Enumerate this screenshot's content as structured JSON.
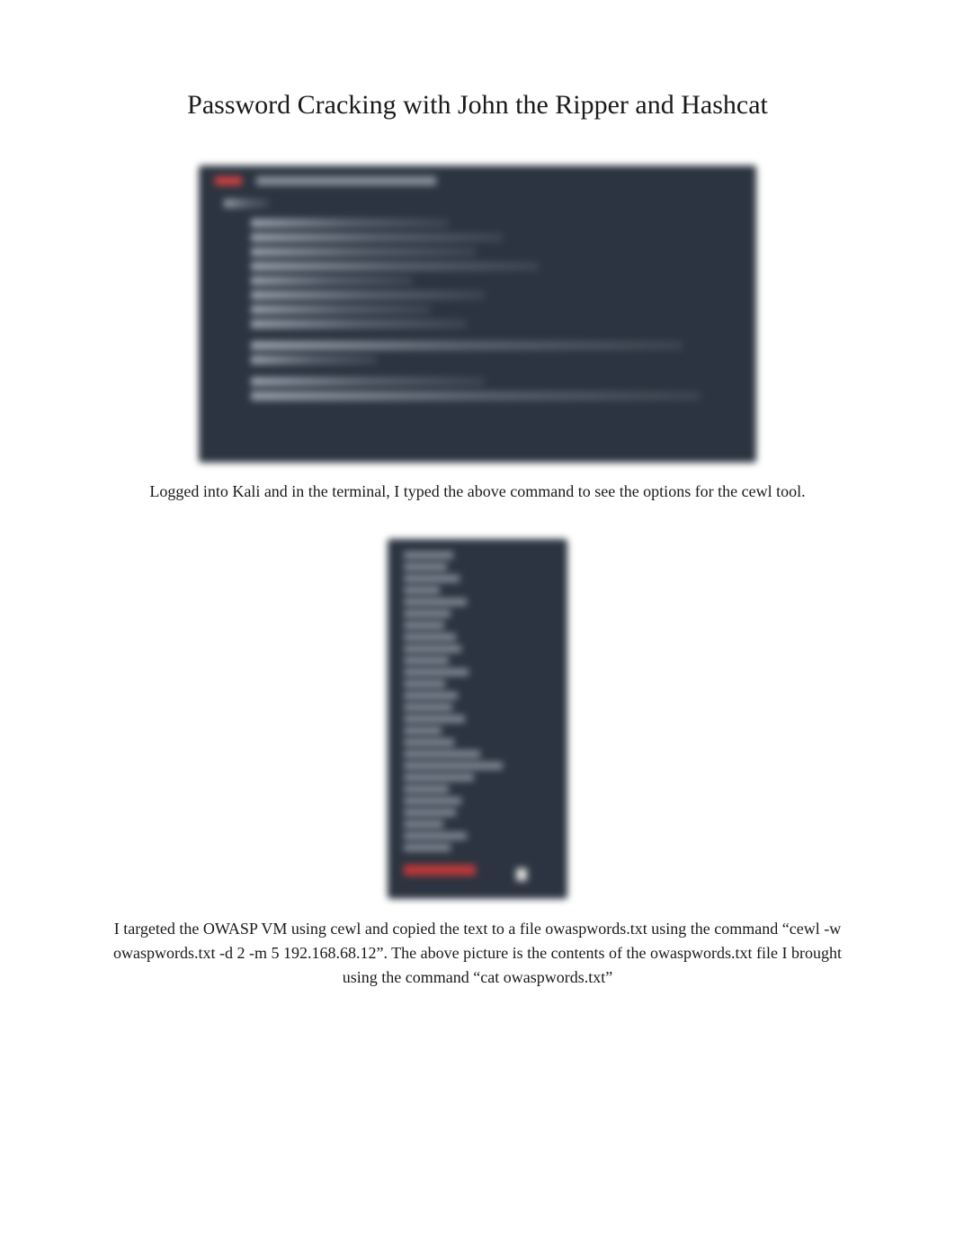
{
  "title": "Password Cracking with John the Ripper and Hashcat",
  "captions": {
    "first": "Logged into Kali and in the terminal, I typed the above command to see the options for the cewl tool.",
    "second": "I targeted the OWASP VM using cewl and copied the text to a file owaspwords.txt using the command “cewl -w owaspwords.txt -d 2 -m 5 192.168.68.12”. The above picture is the contents of the owaspwords.txt file I brought using the command “cat owaspwords.txt”"
  },
  "screenshot1": {
    "description": "blurred-terminal-cewl-help"
  },
  "screenshot2": {
    "description": "blurred-terminal-owaspwords-contents"
  }
}
